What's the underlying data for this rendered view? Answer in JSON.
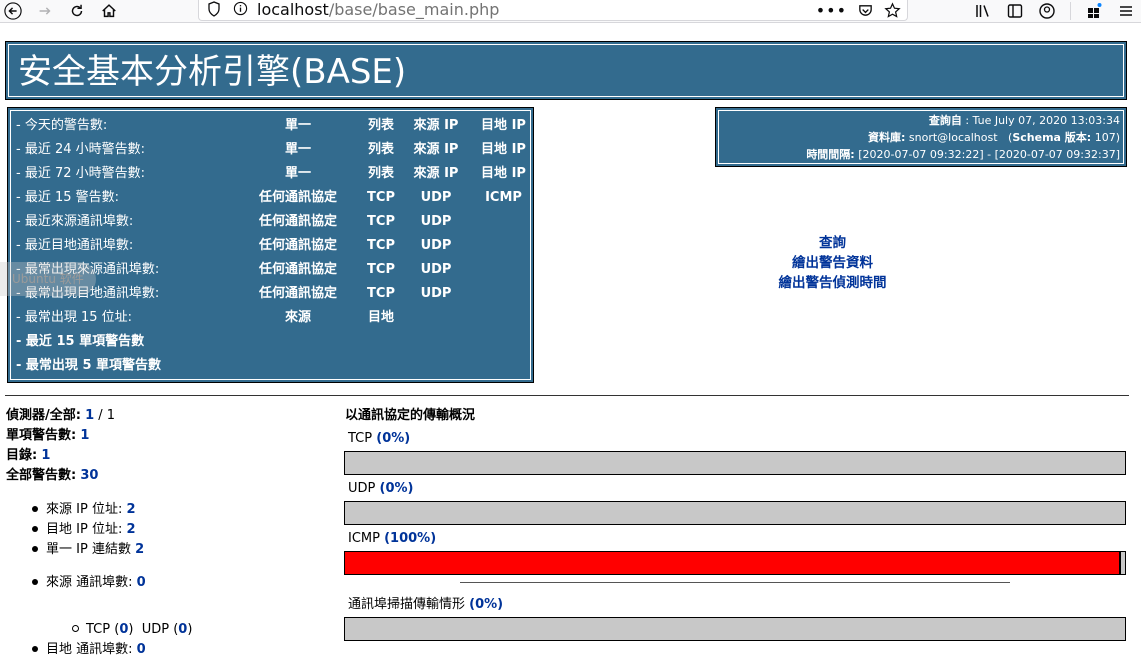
{
  "browser": {
    "url_host": "localhost",
    "url_path": "/base/base_main.php"
  },
  "page": {
    "title": "安全基本分析引擎(BASE)"
  },
  "alert_menu": {
    "rows": [
      {
        "label": "- 今天的警告數:",
        "bold": false,
        "cells": [
          "單一",
          "列表",
          "來源 IP",
          "目地 IP"
        ]
      },
      {
        "label": "- 最近 24 小時警告數:",
        "bold": false,
        "cells": [
          "單一",
          "列表",
          "來源 IP",
          "目地 IP"
        ]
      },
      {
        "label": "- 最近 72 小時警告數:",
        "bold": false,
        "cells": [
          "單一",
          "列表",
          "來源 IP",
          "目地 IP"
        ]
      },
      {
        "label": "- 最近 15 警告數:",
        "bold": false,
        "cells": [
          "任何通訊協定",
          "TCP",
          "UDP",
          "ICMP"
        ]
      },
      {
        "label": "- 最近來源通訊埠數:",
        "bold": false,
        "cells": [
          "任何通訊協定",
          "TCP",
          "UDP",
          ""
        ]
      },
      {
        "label": "- 最近目地通訊埠數:",
        "bold": false,
        "cells": [
          "任何通訊協定",
          "TCP",
          "UDP",
          ""
        ]
      },
      {
        "label": "- 最常出現來源通訊埠數:",
        "bold": false,
        "cells": [
          "任何通訊協定",
          "TCP",
          "UDP",
          ""
        ]
      },
      {
        "label": "- 最常出現目地通訊埠數:",
        "bold": false,
        "cells": [
          "任何通訊協定",
          "TCP",
          "UDP",
          ""
        ]
      },
      {
        "label": "- 最常出現 15 位址:",
        "bold": false,
        "cells": [
          "來源",
          "目地",
          "",
          ""
        ]
      },
      {
        "label": "- 最近 15 單項警告數",
        "bold": true,
        "cells": [
          "",
          "",
          "",
          ""
        ]
      },
      {
        "label": "- 最常出現 5 單項警告數",
        "bold": true,
        "cells": [
          "",
          "",
          "",
          ""
        ]
      }
    ]
  },
  "query_info": {
    "query_label": "查詢自",
    "query_value": " : Tue July 07, 2020 13:03:34",
    "db_label": "資料庫:",
    "db_value": " snort@localhost   (",
    "schema_label": "Schema 版本:",
    "schema_value": " 107)",
    "time_label": "時間間隔:",
    "time_value": " [2020-07-07 09:32:22] - [2020-07-07 09:32:37]"
  },
  "mid_links": [
    "查詢",
    "繪出警告資料",
    "繪出警告偵測時間"
  ],
  "overlay": {
    "ghost_text": "Ubuntu 软件"
  },
  "stats": {
    "sensors_label": "偵測器/全部:",
    "sensors_value": "1",
    "sensors_total": " / 1",
    "unique_label": "單項警告數:",
    "unique_value": "1",
    "categories_label": "目錄:",
    "categories_value": "1",
    "total_label": "全部警告數:",
    "total_value": "30",
    "src_ip_label": "來源 IP 位址:",
    "src_ip_value": "2",
    "dst_ip_label": "目地 IP 位址:",
    "dst_ip_value": "2",
    "unique_ip_label": "單一 IP 連結數",
    "unique_ip_value": "2",
    "src_port_label": "來源 通訊埠數:",
    "src_port_value": "0",
    "tcp_label": "TCP (",
    "tcp_value": "0",
    "udp_label": ")  UDP (",
    "udp_value": "0",
    "close_paren": ")",
    "dst_port_label": "目地 通訊埠數:",
    "dst_port_value": "0"
  },
  "protocols": {
    "title": "以通訊協定的傳輸概況",
    "items": [
      {
        "name": "TCP",
        "pct_text": "(0%)",
        "percent": 0
      },
      {
        "name": "UDP",
        "pct_text": "(0%)",
        "percent": 0
      },
      {
        "name": "ICMP",
        "pct_text": "(100%)",
        "percent": 100
      }
    ],
    "portscan_label": "通訊埠掃描傳輸情形",
    "portscan_pct_text": "(0%)",
    "portscan_percent": 0
  },
  "colors": {
    "header_bg": "#336b8e",
    "link": "#003399",
    "bar_bg": "#c8c8c8",
    "bar_fill": "#ff0000"
  }
}
